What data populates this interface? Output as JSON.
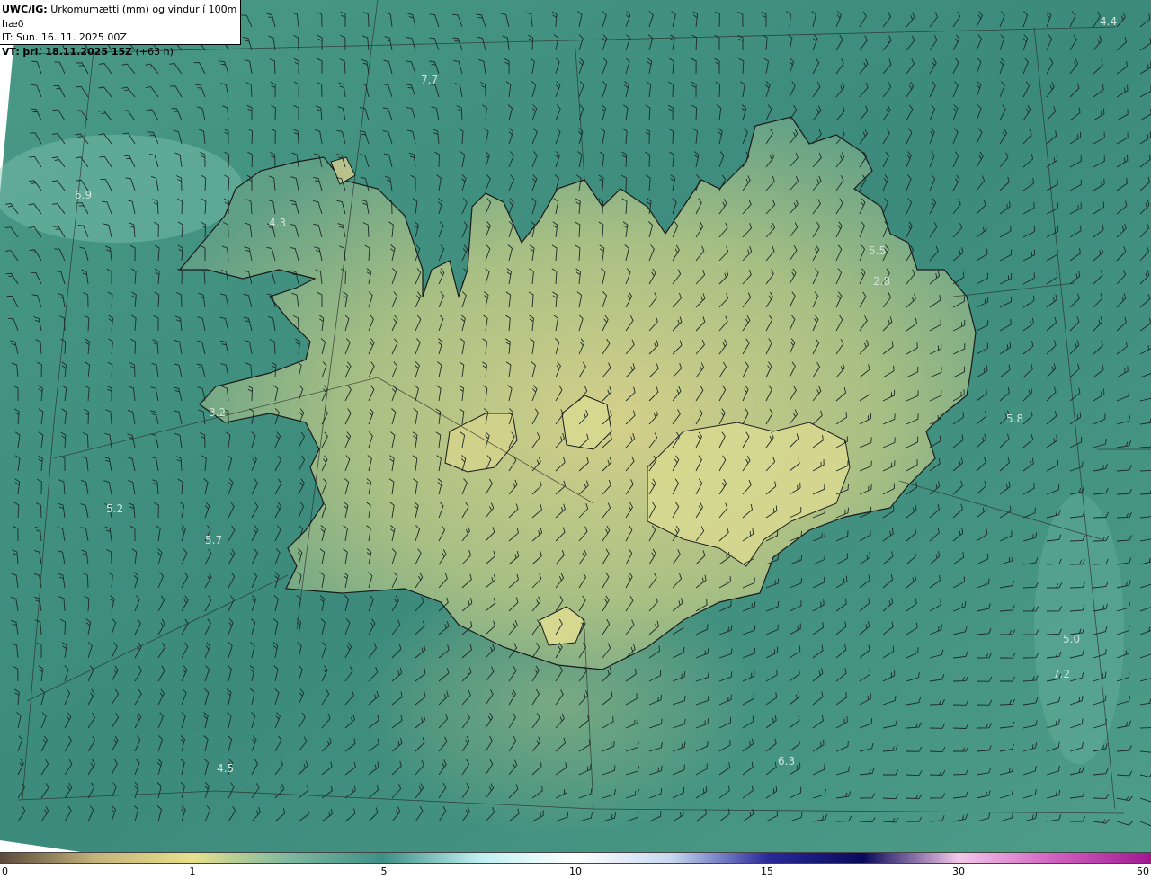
{
  "header": {
    "model": "UWC/IG:",
    "description": "Úrkomumætti (mm) og vindur í 100m hæð",
    "initial_time_label": "IT:",
    "initial_time": "Sun. 16. 11. 2025 00Z",
    "valid_time_label": "VT:",
    "valid_time": "þri. 18.11.2025 15Z",
    "lead_time": "(+63 h)"
  },
  "map_labels": [
    "4.4",
    "7.7",
    "6.9",
    "4.3",
    "5.5",
    "2.8",
    "3.2",
    "5.8",
    "5.2",
    "5.7",
    "5.0",
    "7.2",
    "4.5",
    "6.3"
  ],
  "colorbar": {
    "ticks": [
      "0",
      "1",
      "5",
      "10",
      "15",
      "30",
      "50"
    ],
    "colors": [
      "#5a4a3a",
      "#c4b37a",
      "#e6e08c",
      "#7fb8a0",
      "#3d8f85",
      "#bff0f0",
      "#ffffff",
      "#c8d8f0",
      "#2a2a9a",
      "#0a0a5a",
      "#f4c8e8",
      "#d060c0",
      "#a01890"
    ]
  },
  "colors": {
    "sea": "#3f8f7f",
    "land_low": "#5aa085",
    "land_high": "#c8cc86",
    "coast": "#1a1a1a"
  }
}
